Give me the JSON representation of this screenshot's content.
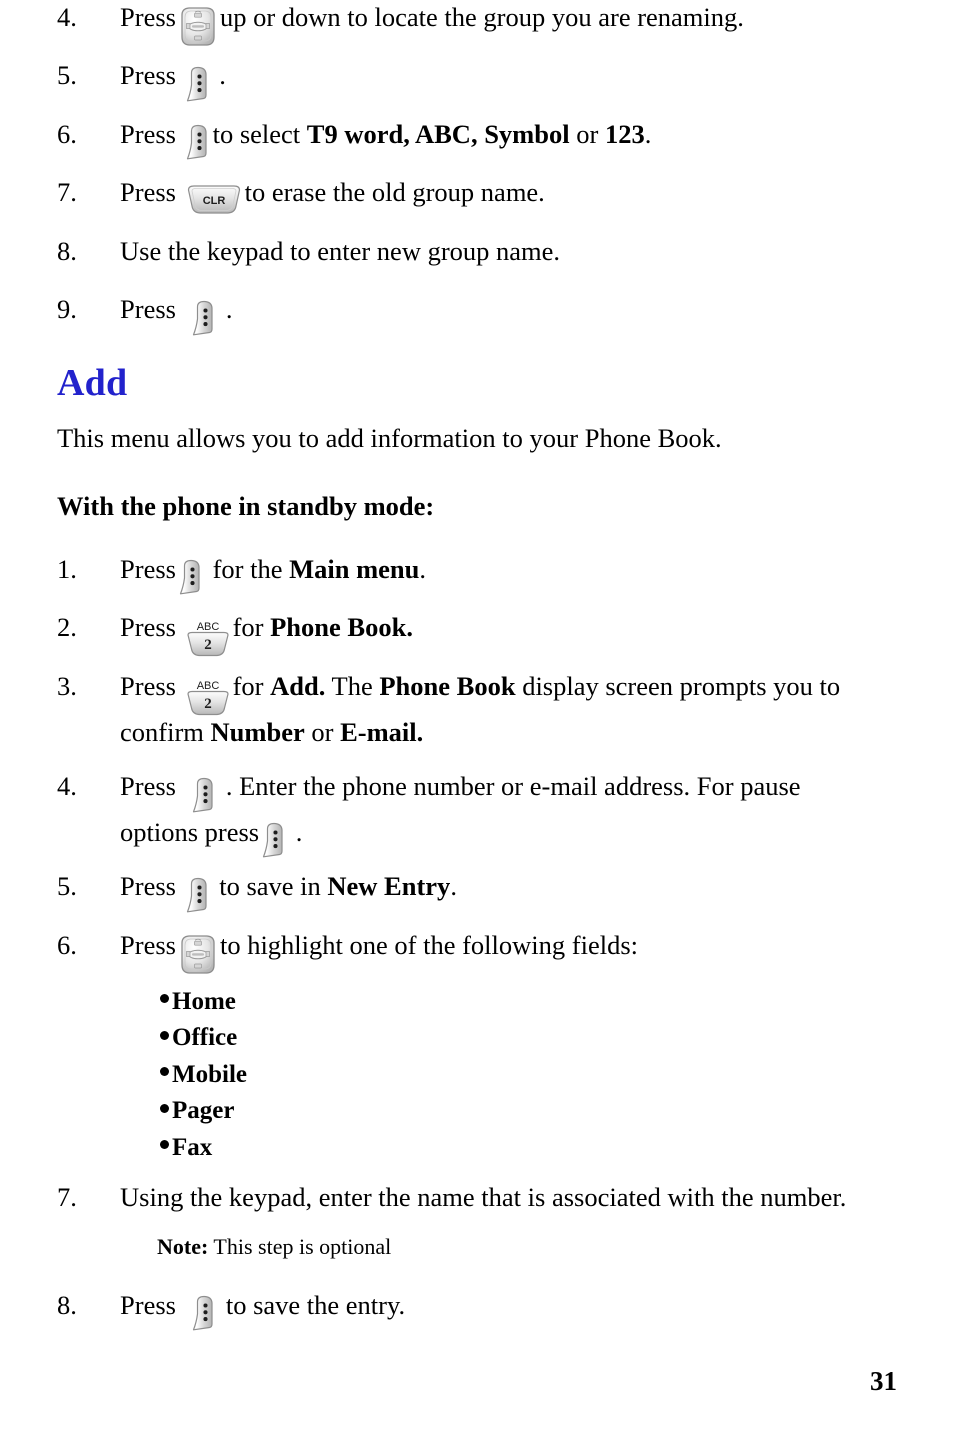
{
  "document": {
    "page_number": "31",
    "heading": "Add",
    "intro_paragraph": "This menu allows you to add information to your Phone Book.",
    "subheading": "With the phone in standby mode:"
  },
  "icons": {
    "soft_key": "soft-menu-key-icon",
    "nav_key": "navigation-key-icon",
    "clr_key": "clr-key-icon",
    "clr_label": "CLR",
    "num_key_2": "keypad-2-abc-key-icon",
    "num_key_2_letters": "ABC",
    "num_key_2_digit": "2"
  },
  "top_steps": [
    {
      "number": "4.",
      "pre": "Press",
      "icon": "nav",
      "post": "up or down to locate the group you are renaming."
    },
    {
      "number": "5.",
      "pre": "Press",
      "icon": "soft",
      "post": "."
    },
    {
      "number": "6.",
      "pre": "Press",
      "icon": "soft",
      "post_a": "to select ",
      "bold_a": "T9 word, ABC, Symbol",
      "post_b": " or ",
      "bold_b": "123",
      "post_c": "."
    },
    {
      "number": "7.",
      "pre": "Press",
      "icon": "clr",
      "post": "to erase the old group name."
    },
    {
      "number": "8.",
      "text": "Use the keypad to enter new group name."
    },
    {
      "number": "9.",
      "pre": "Press",
      "icon": "soft",
      "post": "."
    }
  ],
  "add_steps": [
    {
      "number": "1.",
      "pre": "Press",
      "icon": "soft",
      "post_a": "for the ",
      "bold_a": "Main menu",
      "post_c": "."
    },
    {
      "number": "2.",
      "pre": "Press",
      "icon": "num2",
      "post_a": "for ",
      "bold_a": "Phone Book.",
      "post_c": ""
    },
    {
      "number": "3.",
      "pre": "Press",
      "icon": "num2",
      "post_a": "for ",
      "bold_a": "Add.",
      "post_b": " The ",
      "bold_b": "Phone Book",
      "post_c": " display screen prompts you to",
      "line2_a": "confirm ",
      "line2_bold_a": "Number",
      "line2_b": " or ",
      "line2_bold_b": "E-mail."
    },
    {
      "number": "4.",
      "pre": "Press",
      "icon": "soft",
      "post_a": ". Enter the phone number or e-mail address. For pause",
      "line2_a": "options press",
      "line2_icon": "soft",
      "line2_b": "."
    },
    {
      "number": "5.",
      "pre": "Press",
      "icon": "soft",
      "post_a": "to save in ",
      "bold_a": "New Entry",
      "post_c": "."
    },
    {
      "number": "6.",
      "pre": "Press",
      "icon": "nav",
      "post": "to highlight one of the following fields:"
    },
    {
      "number": "7.",
      "text": "Using the keypad, enter the name that is associated with the number."
    },
    {
      "number": "8.",
      "pre": "Press",
      "icon": "soft",
      "post": "to save the entry."
    }
  ],
  "field_bullets": [
    "Home",
    "Office",
    "Mobile",
    "Pager",
    "Fax"
  ],
  "note": {
    "label": "Note:",
    "text": " This step is optional"
  },
  "colors": {
    "heading_blue": "#2222cc",
    "text_black": "#000000",
    "page_background": "#ffffff"
  }
}
